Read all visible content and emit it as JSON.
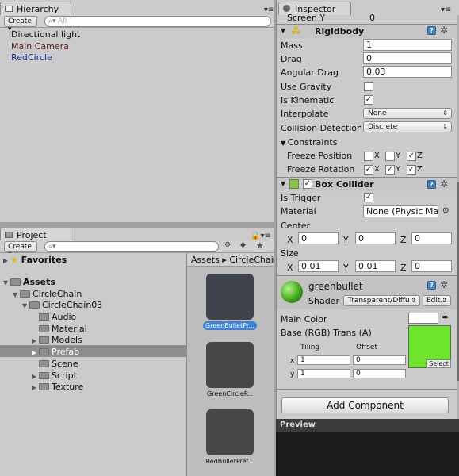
{
  "hierarchy": {
    "tab": "Hierarchy",
    "create": "Create",
    "search_placeholder": "All",
    "items": [
      "Directional light",
      "Main Camera",
      "RedCircle"
    ]
  },
  "project": {
    "tab": "Project",
    "create": "Create",
    "favorites": "Favorites",
    "assets": "Assets",
    "tree": [
      "CircleChain",
      "CircleChain03",
      "Audio",
      "Material",
      "Models",
      "Prefab",
      "Scene",
      "Script",
      "Texture"
    ],
    "breadcrumb": [
      "Assets",
      "CircleChain"
    ],
    "thumbs": [
      "GreenBulletPr...",
      "GreenCircleP...",
      "RedBulletPref..."
    ]
  },
  "inspector": {
    "tab": "Inspector",
    "screen_y_label": "Screen Y",
    "screen_y_value": "0",
    "rigidbody": {
      "title": "Rigidbody",
      "mass_label": "Mass",
      "mass": "1",
      "drag_label": "Drag",
      "drag": "0",
      "angular_label": "Angular Drag",
      "angular": "0.03",
      "gravity_label": "Use Gravity",
      "kinematic_label": "Is Kinematic",
      "interpolate_label": "Interpolate",
      "interpolate": "None",
      "collision_label": "Collision Detection",
      "collision": "Discrete",
      "constraints_label": "Constraints",
      "freeze_pos_label": "Freeze Position",
      "freeze_rot_label": "Freeze Rotation",
      "x": "X",
      "y": "Y",
      "z": "Z"
    },
    "box": {
      "title": "Box Collider",
      "trigger_label": "Is Trigger",
      "material_label": "Material",
      "material": "None (Physic Mate",
      "center_label": "Center",
      "cx": "0",
      "cy": "0",
      "cz": "0",
      "size_label": "Size",
      "sx": "0.01",
      "sy": "0.01",
      "sz": "0",
      "x": "X",
      "y": "Y",
      "z": "Z"
    },
    "material": {
      "name": "greenbullet",
      "shader_label": "Shader",
      "shader": "Transparent/Diffu",
      "edit": "Edit...",
      "main_color_label": "Main Color",
      "base_label": "Base (RGB) Trans (A)",
      "tiling_label": "Tiling",
      "offset_label": "Offset",
      "x": "x",
      "y": "y",
      "tx": "1",
      "ox": "0",
      "ty": "1",
      "oy": "0",
      "select": "Select",
      "swatch_color": "#6de52a"
    },
    "add_component": "Add Component",
    "preview": "Preview"
  }
}
